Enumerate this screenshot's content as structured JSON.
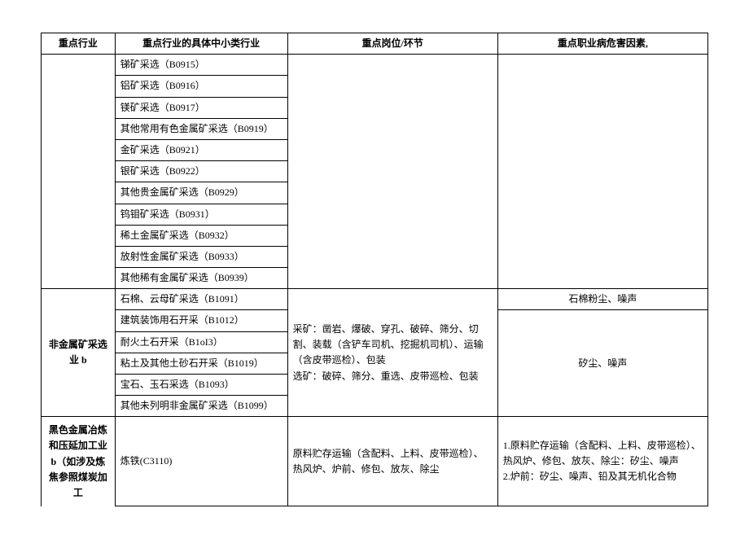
{
  "header": {
    "col1": "重点行业",
    "col2": "重点行业的具体中小类行业",
    "col3": "重点岗位/环节",
    "col4": "重点职业病危害因素,"
  },
  "group1": {
    "items": [
      "锑矿采选（B0915）",
      "铝矿采选（B0916）",
      "镁矿采选（B0917）",
      "其他常用有色金属矿采选（B0919）",
      "金矿采选（B0921）",
      "银矿采选（B0922）",
      "其他贵金属矿采选（B0929）",
      "钨钼矿采选（B0931）",
      "稀土金属矿采选（B0932）",
      "放射性金属矿采选（B0933）",
      "其他稀有金属矿采选（B0939）"
    ]
  },
  "group2": {
    "industry": "非金属矿采选业 b",
    "items": [
      "石棉、云母矿采选（B1091）",
      "建筑装饰用石开采（B1012）",
      "耐火土石开采（B1oI3）",
      "粘土及其他土砂石开采（B1019）",
      "宝石、玉石采选（B1093）",
      "其他未列明非金属矿采选（B1099）"
    ],
    "posts": "采矿：凿岩、爆破、穿孔、破碎、筛分、切割、装载（含铲车司机、挖掘机司机）、运输（含皮带巡检）、包装\n选矿：破碎、筛分、重选、皮带巡检、包装",
    "hazard_row1": "石棉粉尘、噪声",
    "hazard_row3": "矽尘、噪声"
  },
  "group3": {
    "industry": "黑色金属冶炼和压延加工业 b（如涉及炼焦参照煤炭加工",
    "item": "炼铁(C3110)",
    "posts": "原料贮存运输（含配料、上料、皮带巡检）、热风炉、炉前、修包、放灰、除尘",
    "hazard": "1.原料贮存运输（含配料、上料、皮带巡检）、热风炉、修包、放灰、除尘：矽尘、噪声\n2.炉前：矽尘、噪声、铅及其无机化合物"
  }
}
